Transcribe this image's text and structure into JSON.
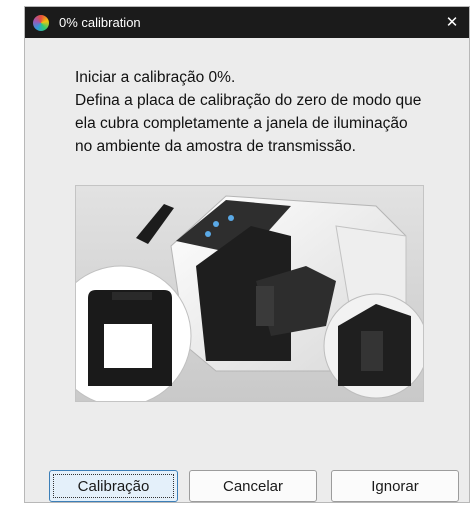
{
  "window": {
    "title": "0% calibration",
    "close_glyph": "✕"
  },
  "message": {
    "line1": "Iniciar a calibração 0%.",
    "line2": "Defina a placa de calibração do zero de modo que ela cubra completamente a janela de iluminação no ambiente da amostra de transmissão."
  },
  "illustration": {
    "description_icon": "spectrophotometer-with-zero-calibration-plate"
  },
  "buttons": {
    "calibrate": "Calibração",
    "cancel": "Cancelar",
    "ignore": "Ignorar"
  },
  "colors": {
    "titlebar": "#1b1b1b",
    "dialog_bg": "#ececec",
    "primary_border": "#3c7fb8"
  }
}
